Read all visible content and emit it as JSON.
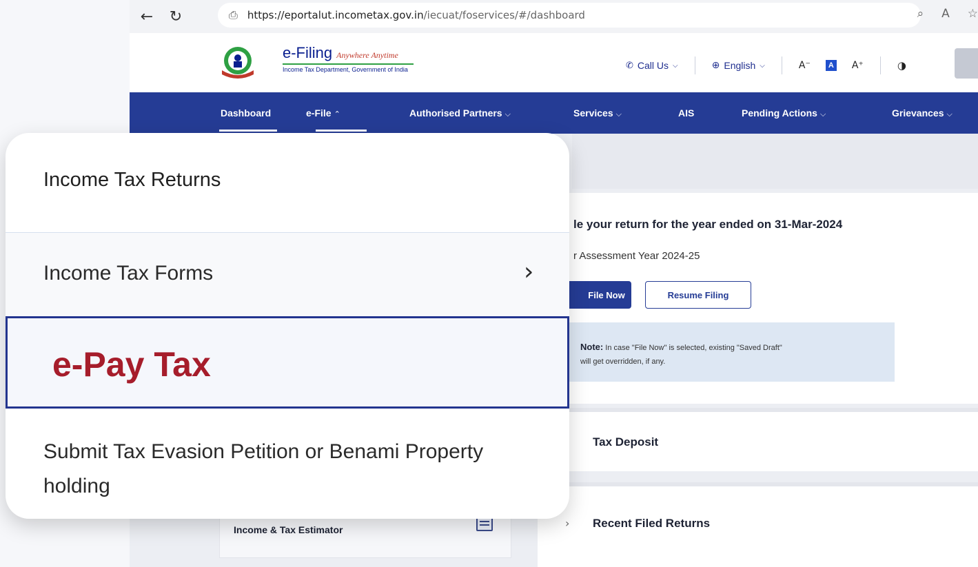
{
  "browser": {
    "url_host": "https://eportalut.incometax.gov.in",
    "url_path": "/iecuat/foservices/#/dashboard"
  },
  "header": {
    "brand_title": "e-Filing",
    "brand_tagline": "Anywhere Anytime",
    "brand_subtitle": "Income Tax Department, Government of India",
    "call_us": "Call Us",
    "language": "English"
  },
  "nav": {
    "items": [
      "Dashboard",
      "e-File",
      "Authorised Partners",
      "Services",
      "AIS",
      "Pending Actions",
      "Grievances"
    ]
  },
  "panel": {
    "title": "le your return for the year ended on 31-Mar-2024",
    "subtitle": "r Assessment Year 2024-25",
    "file_now": "File Now",
    "resume_filing": "Resume Filing",
    "note_label": "Note:",
    "note_text": " In case \"File Now\" is selected, existing \"Saved Draft\"",
    "note_text2": "will get overridden, if any."
  },
  "accordions": {
    "tax_deposit": "Tax Deposit",
    "recent_returns": "Recent Filed Returns"
  },
  "side": {
    "estimator": "Income & Tax Estimator"
  },
  "menu": {
    "returns": "Income Tax Returns",
    "forms": "Income Tax Forms",
    "epay": "e-Pay Tax",
    "submit": "Submit Tax Evasion Petition or Benami Property holding"
  },
  "colors": {
    "nav_blue": "#253c95",
    "epay_red": "#a61d2b"
  }
}
